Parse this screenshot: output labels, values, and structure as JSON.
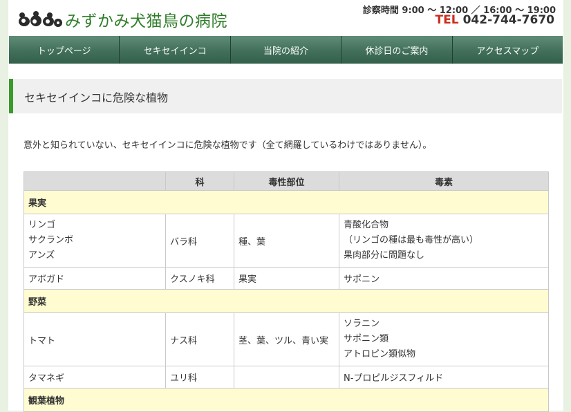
{
  "header": {
    "site_title": "みずかみ犬猫鳥の病院",
    "hours": "診察時間 9:00 〜 12:00 ／ 16:00 〜 19:00",
    "tel_label": "TEL",
    "tel_number": "042-744-7670"
  },
  "nav": {
    "items": [
      {
        "label": "トップページ"
      },
      {
        "label": "セキセイインコ"
      },
      {
        "label": "当院の紹介"
      },
      {
        "label": "休診日のご案内"
      },
      {
        "label": "アクセスマップ"
      }
    ]
  },
  "page": {
    "heading": "セキセイインコに危険な植物",
    "intro": "意外と知られていない、セキセイインコに危険な植物です（全て網羅しているわけではありません）。"
  },
  "table": {
    "headers": [
      "",
      "科",
      "毒性部位",
      "毒素"
    ],
    "categories": [
      {
        "name": "果実",
        "rows": [
          {
            "plants": [
              "リンゴ",
              "サクランボ",
              "アンズ"
            ],
            "family": "バラ科",
            "part": "種、葉",
            "toxin": [
              "青酸化合物",
              "（リンゴの種は最も毒性が高い）",
              "果肉部分に問題なし"
            ]
          },
          {
            "plants": [
              "アボガド"
            ],
            "family": "クスノキ科",
            "part": "果実",
            "toxin": [
              "サポニン"
            ]
          }
        ]
      },
      {
        "name": "野菜",
        "rows": [
          {
            "plants": [
              "トマト"
            ],
            "family": "ナス科",
            "part": "茎、葉、ツル、青い実",
            "toxin": [
              "ソラニン",
              "サポニン類",
              "アトロピン類似物"
            ]
          },
          {
            "plants": [
              "タマネギ"
            ],
            "family": "ユリ科",
            "part": "",
            "toxin": [
              "N-プロピルジスフィルド"
            ]
          }
        ]
      },
      {
        "name": "観葉植物",
        "rows": []
      }
    ]
  },
  "colors": {
    "title_green": "#2f7d2a",
    "nav_green": "#416f5a",
    "tel_red": "#cc2b1c",
    "category_bg": "#fffcd2",
    "header_row_bg": "#dcdcdc",
    "accent_green": "#3b9a2c"
  }
}
